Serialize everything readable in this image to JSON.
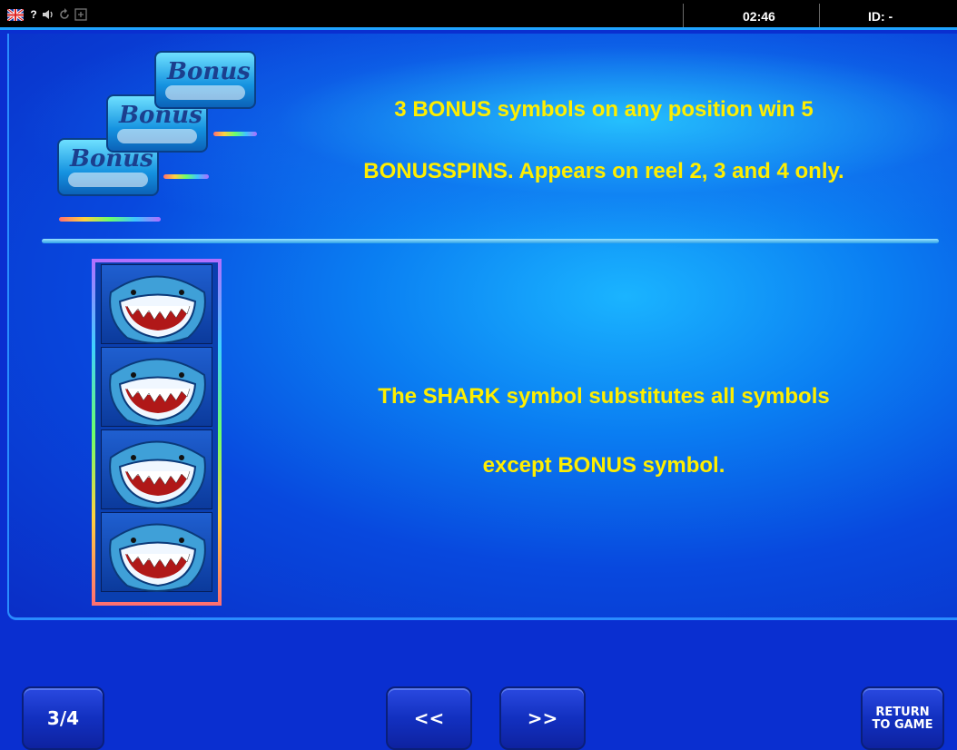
{
  "topbar": {
    "help_label": "?",
    "clock": "02:46",
    "id_label": "ID: -",
    "icons": [
      "uk-flag-icon",
      "help-icon",
      "sound-icon",
      "reload-icon",
      "fullscreen-icon"
    ]
  },
  "paytable": {
    "bonus": {
      "symbol_text": "Bonus",
      "line1": "3 BONUS symbols on any position win 5",
      "line2": "BONUSSPINS. Appears on reel 2, 3 and 4 only."
    },
    "shark": {
      "line1": "The SHARK symbol substitutes all symbols",
      "line2": "except BONUS symbol."
    }
  },
  "nav": {
    "page_indicator": "3/4",
    "prev_label": "<<",
    "next_label": ">>",
    "return_line1": "RETURN",
    "return_line2": "TO GAME"
  },
  "colors": {
    "accent_text": "#ffee00",
    "panel_blue": "#0a7ef2",
    "topbar_border": "#1fa3ff"
  }
}
